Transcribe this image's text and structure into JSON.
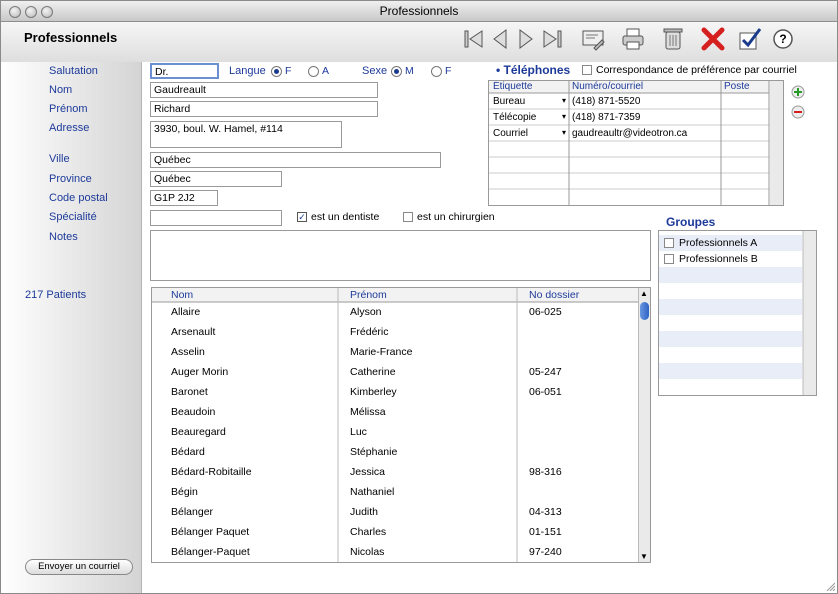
{
  "window": {
    "title": "Professionnels"
  },
  "header": {
    "title": "Professionnels"
  },
  "form": {
    "salutation_label": "Salutation",
    "salutation_value": "Dr.",
    "langue_label": "Langue",
    "langue_f": "F",
    "langue_a": "A",
    "sexe_label": "Sexe",
    "sexe_m": "M",
    "sexe_f": "F",
    "nom_label": "Nom",
    "nom_value": "Gaudreault",
    "prenom_label": "Prénom",
    "prenom_value": "Richard",
    "adresse_label": "Adresse",
    "adresse_value": "3930, boul. W. Hamel, #114",
    "ville_label": "Ville",
    "ville_value": "Québec",
    "province_label": "Province",
    "province_value": "Québec",
    "code_label": "Code postal",
    "code_value": "G1P 2J2",
    "specialite_label": "Spécialité",
    "specialite_value": "",
    "dentiste_label": "est un dentiste",
    "chirurgien_label": "est un chirurgien",
    "notes_label": "Notes",
    "notes_value": ""
  },
  "phones": {
    "title": "• Téléphones",
    "pref_label": "Correspondance de préférence par courriel",
    "headers": [
      "Étiquette",
      "Numéro/courriel",
      "Poste"
    ],
    "rows": [
      {
        "label": "Bureau",
        "number": "(418) 871-5520",
        "ext": ""
      },
      {
        "label": "Télécopie",
        "number": "(418) 871-7359",
        "ext": ""
      },
      {
        "label": "Courriel",
        "number": "gaudreaultr@videotron.ca",
        "ext": ""
      }
    ]
  },
  "groups": {
    "title": "Groupes",
    "items": [
      "Professionnels A",
      "Professionnels B"
    ]
  },
  "patients": {
    "count_label": "217 Patients",
    "headers": [
      "Nom",
      "Prénom",
      "No dossier"
    ],
    "rows": [
      {
        "nom": "Allaire",
        "prenom": "Alyson",
        "dossier": "06-025"
      },
      {
        "nom": "Arsenault",
        "prenom": "Frédéric",
        "dossier": ""
      },
      {
        "nom": "Asselin",
        "prenom": "Marie-France",
        "dossier": ""
      },
      {
        "nom": "Auger Morin",
        "prenom": "Catherine",
        "dossier": "05-247"
      },
      {
        "nom": "Baronet",
        "prenom": "Kimberley",
        "dossier": "06-051"
      },
      {
        "nom": "Beaudoin",
        "prenom": "Mélissa",
        "dossier": ""
      },
      {
        "nom": "Beauregard",
        "prenom": "Luc",
        "dossier": ""
      },
      {
        "nom": "Bédard",
        "prenom": "Stéphanie",
        "dossier": ""
      },
      {
        "nom": "Bédard-Robitaille",
        "prenom": "Jessica",
        "dossier": "98-316"
      },
      {
        "nom": "Bégin",
        "prenom": "Nathaniel",
        "dossier": ""
      },
      {
        "nom": "Bélanger",
        "prenom": "Judith",
        "dossier": "04-313"
      },
      {
        "nom": "Bélanger Paquet",
        "prenom": "Charles",
        "dossier": "01-151"
      },
      {
        "nom": "Bélanger-Paquet",
        "prenom": "Nicolas",
        "dossier": "97-240"
      }
    ]
  },
  "footer": {
    "email_button": "Envoyer un courriel"
  },
  "colors": {
    "label_blue": "#1d3a9a",
    "delete_red": "#d62020",
    "row_blue": "#e8edf8"
  }
}
